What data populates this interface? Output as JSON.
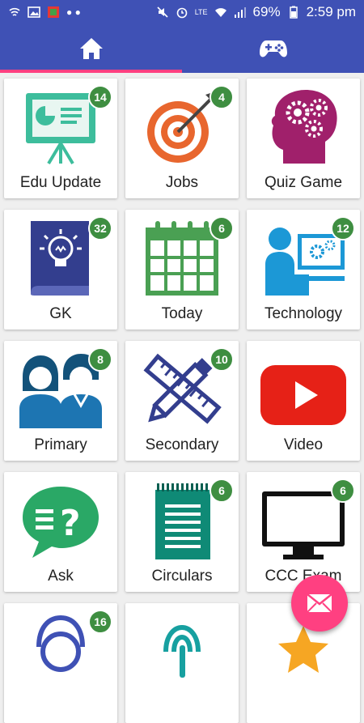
{
  "statusbar": {
    "battery": "69%",
    "time": "2:59 pm",
    "network": "LTE"
  },
  "tabs": [
    {
      "name": "home-icon"
    },
    {
      "name": "gamepad-icon"
    }
  ],
  "colors": {
    "primary": "#3f51b5",
    "accent": "#ff4081",
    "badge": "#3e8e41"
  },
  "cards": [
    {
      "label": "Edu Update",
      "badge": "14"
    },
    {
      "label": "Jobs",
      "badge": "4"
    },
    {
      "label": "Quiz Game",
      "badge": ""
    },
    {
      "label": "GK",
      "badge": "32"
    },
    {
      "label": "Today",
      "badge": "6"
    },
    {
      "label": "Technology",
      "badge": "12"
    },
    {
      "label": "Primary",
      "badge": "8"
    },
    {
      "label": "Secondary",
      "badge": "10"
    },
    {
      "label": "Video",
      "badge": ""
    },
    {
      "label": "Ask",
      "badge": ""
    },
    {
      "label": "Circulars",
      "badge": "6"
    },
    {
      "label": "CCC Exam",
      "badge": "6"
    },
    {
      "label": "",
      "badge": "16"
    },
    {
      "label": "",
      "badge": ""
    },
    {
      "label": "",
      "badge": ""
    }
  ],
  "fab": {
    "icon": "mail-icon"
  }
}
